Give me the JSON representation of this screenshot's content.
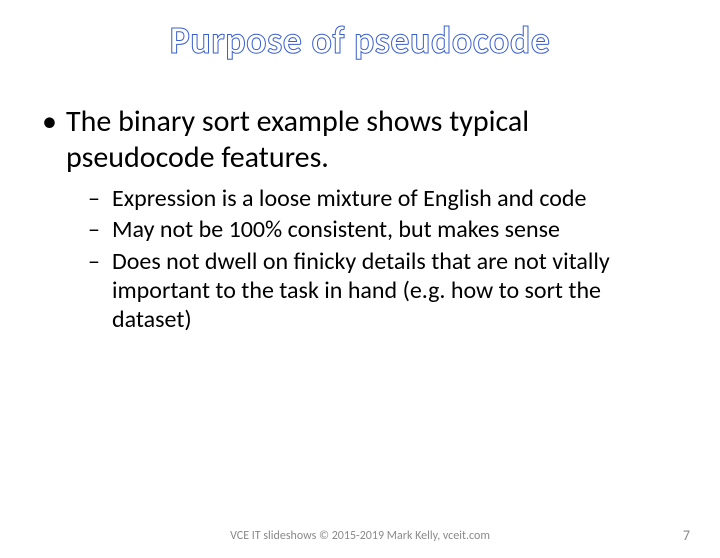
{
  "title": "Purpose of pseudocode",
  "bullets": {
    "main": "The binary sort example shows typical pseudocode features.",
    "sub": [
      "Expression is a loose mixture of English and code",
      "May not be 100% consistent, but makes sense",
      "Does not dwell on finicky details that are not vitally important to the task in hand (e.g. how to sort the dataset)"
    ]
  },
  "footer": {
    "credit": "VCE IT slideshows © 2015-2019 Mark Kelly, vceit.com",
    "page": "7"
  }
}
